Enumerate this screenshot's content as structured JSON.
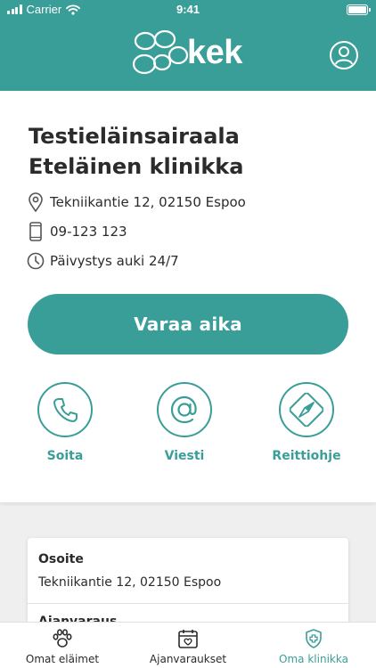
{
  "status_bar": {
    "carrier": "Carrier",
    "time": "9:41"
  },
  "header": {
    "logo_text": "kek",
    "brand_color": "#3a9e98"
  },
  "clinic": {
    "name": "Testieläinsairaala Eteläinen klinikka",
    "address": "Tekniikantie 12, 02150 Espoo",
    "phone": "09-123 123",
    "hours": "Päivystys auki 24/7"
  },
  "book_button": {
    "label": "Varaa aika"
  },
  "actions": [
    {
      "label": "Soita",
      "icon": "phone-icon"
    },
    {
      "label": "Viesti",
      "icon": "at-icon"
    },
    {
      "label": "Reittiohje",
      "icon": "compass-icon"
    }
  ],
  "details": {
    "address_title": "Osoite",
    "address_value": "Tekniikantie 12, 02150 Espoo",
    "booking_title": "Ajanvaraus"
  },
  "tabs": [
    {
      "label": "Omat eläimet",
      "icon": "paw-icon",
      "active": false
    },
    {
      "label": "Ajanvaraukset",
      "icon": "calendar-heart-icon",
      "active": false
    },
    {
      "label": "Oma klinikka",
      "icon": "shield-cross-icon",
      "active": true
    }
  ]
}
